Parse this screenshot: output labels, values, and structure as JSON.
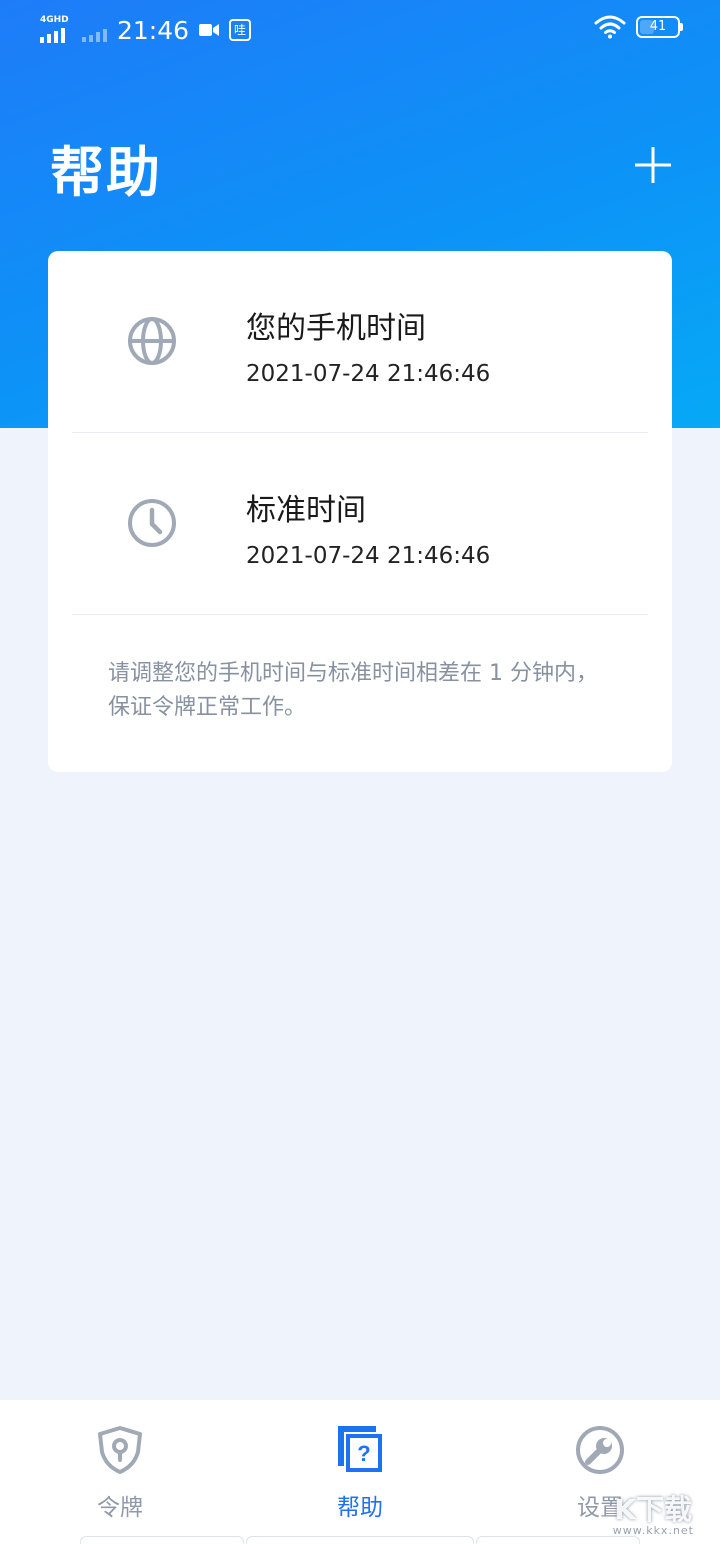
{
  "status_bar": {
    "network": "4GHD",
    "time": "21:46",
    "app_badge": "哇",
    "battery": "41"
  },
  "header": {
    "title": "帮助"
  },
  "card": {
    "rows": [
      {
        "title": "您的手机时间",
        "value": "2021-07-24 21:46:46",
        "icon": "globe-icon"
      },
      {
        "title": "标准时间",
        "value": "2021-07-24 21:46:46",
        "icon": "clock-icon"
      }
    ],
    "note": "请调整您的手机时间与标准时间相差在 1 分钟内，保证令牌正常工作。"
  },
  "bottom_nav": {
    "items": [
      {
        "label": "令牌",
        "icon": "shield-key-icon",
        "active": false
      },
      {
        "label": "帮助",
        "icon": "help-icon",
        "active": true
      },
      {
        "label": "设置",
        "icon": "wrench-icon",
        "active": false
      }
    ]
  },
  "watermark": {
    "text": "K下载",
    "url": "www.kkx.net"
  },
  "colors": {
    "accent": "#1d72f2",
    "header_start": "#1e7cf8",
    "header_end": "#06a9f6",
    "background": "#eff3fb",
    "icon_gray": "#a1a9b7"
  }
}
